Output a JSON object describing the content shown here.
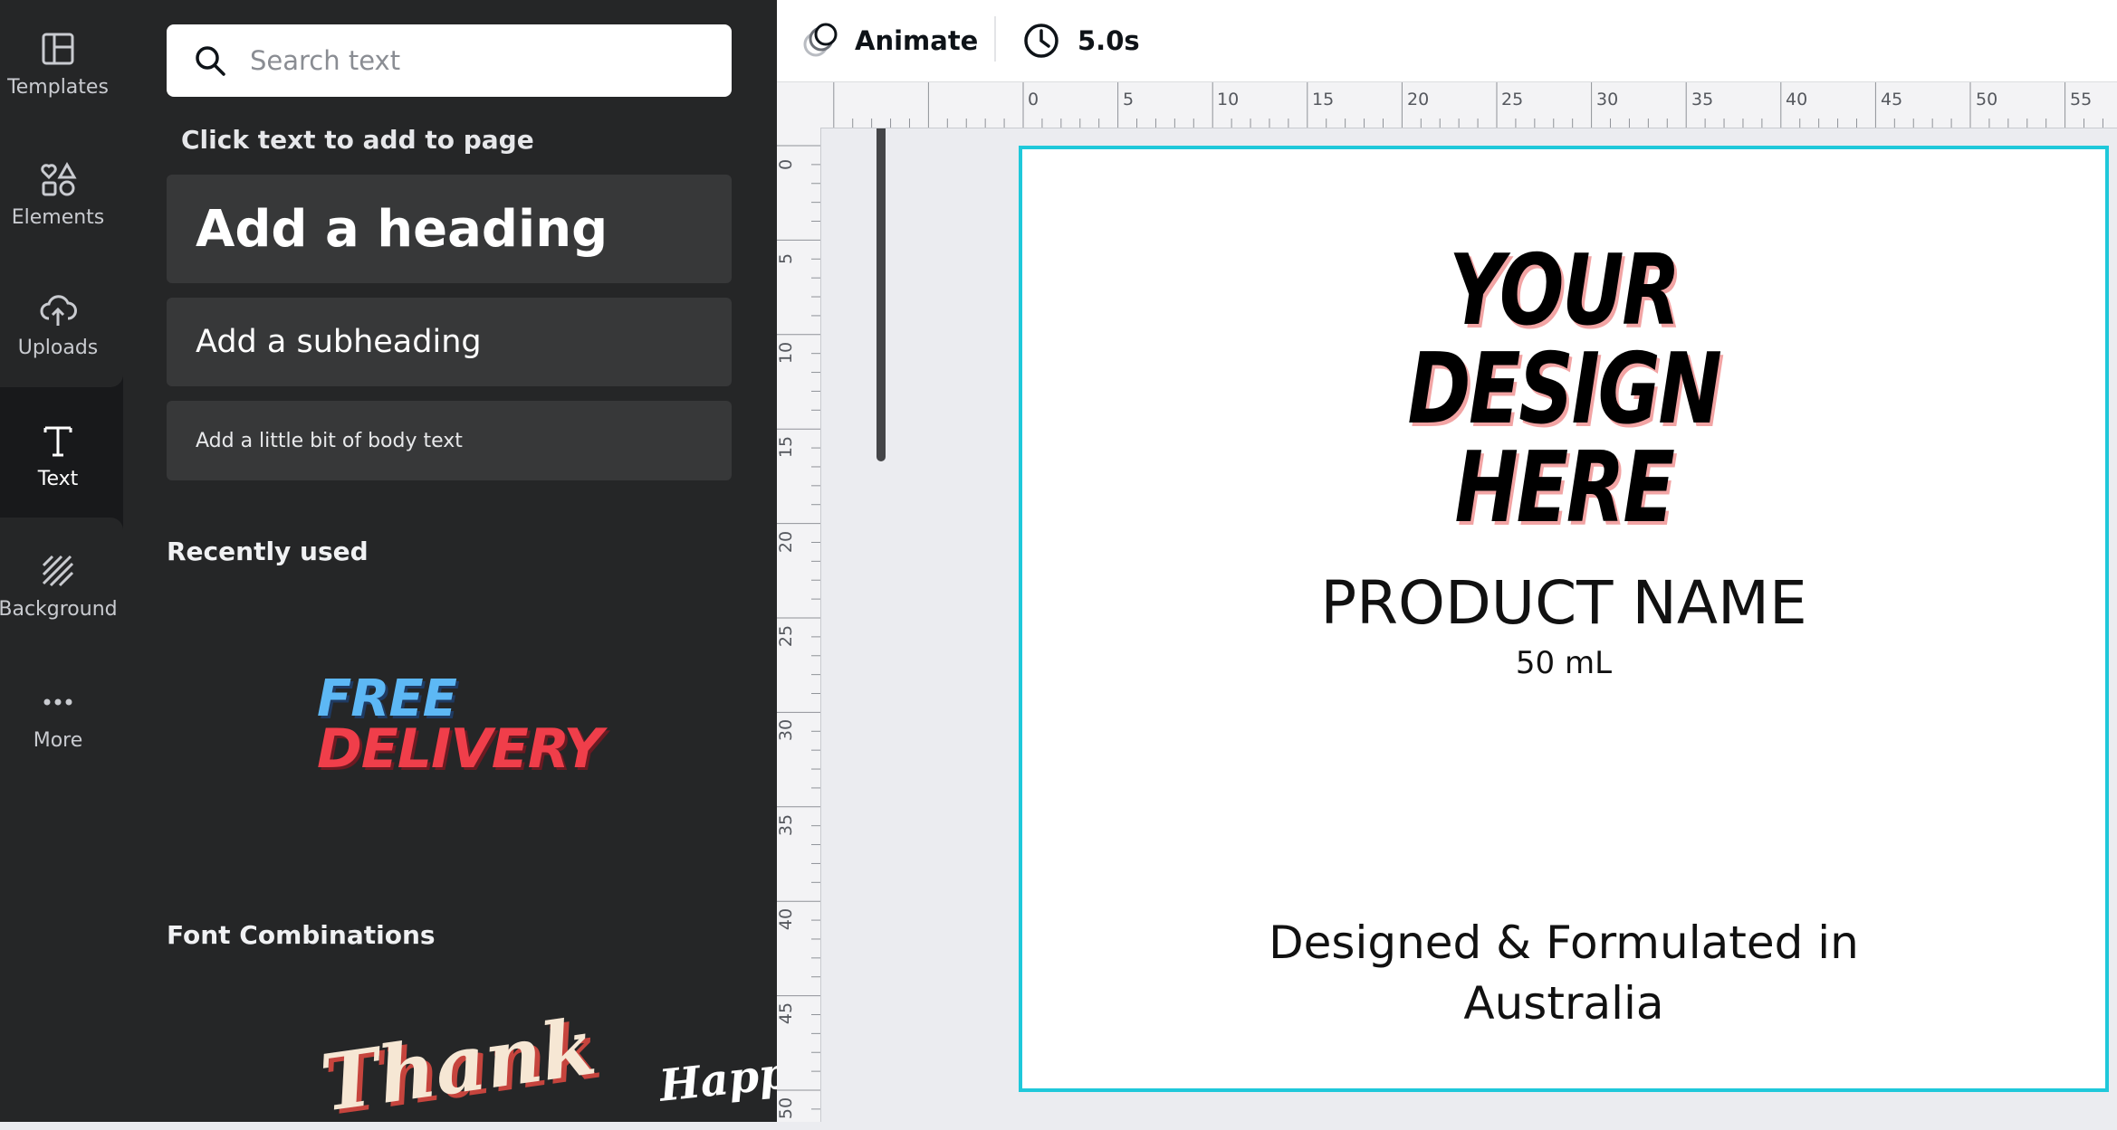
{
  "rail": {
    "items": [
      {
        "label": "Templates",
        "icon": "templates-icon"
      },
      {
        "label": "Elements",
        "icon": "elements-icon"
      },
      {
        "label": "Uploads",
        "icon": "upload-cloud-icon"
      },
      {
        "label": "Text",
        "icon": "text-icon"
      },
      {
        "label": "Background",
        "icon": "background-icon"
      },
      {
        "label": "More",
        "icon": "more-dots-icon"
      }
    ],
    "active": "Text"
  },
  "panel": {
    "search": {
      "placeholder": "Search text",
      "value": ""
    },
    "click_hint": "Click text to add to page",
    "heading_tile": "Add a heading",
    "subheading_tile": "Add a subheading",
    "body_tile": "Add a little bit of body text",
    "recently_used_title": "Recently used",
    "recent_sticker": {
      "line1": "FREE",
      "line2": "DELIVERY"
    },
    "font_combinations_title": "Font Combinations",
    "combo_stickers": [
      "Thank",
      "Happy"
    ]
  },
  "toolbar": {
    "animate_label": "Animate",
    "duration_label": "5.0s"
  },
  "rulers": {
    "top": [
      "0",
      "5",
      "10",
      "15",
      "20",
      "25",
      "30",
      "35",
      "40",
      "45",
      "50",
      "55"
    ],
    "left": [
      "0",
      "5",
      "10",
      "15",
      "20",
      "25",
      "30",
      "35",
      "40",
      "45",
      "50"
    ]
  },
  "canvas": {
    "design_lines": [
      "YOUR",
      "DESIGN",
      "HERE"
    ],
    "product_name": "PRODUCT NAME",
    "volume": "50 mL",
    "footer_lines": [
      "Designed & Formulated in",
      "Australia"
    ],
    "selection_color": "#1fc8da"
  },
  "colors": {
    "panel_bg": "#252627",
    "rail_bg": "#18191b",
    "accent": "#1fc8da"
  }
}
